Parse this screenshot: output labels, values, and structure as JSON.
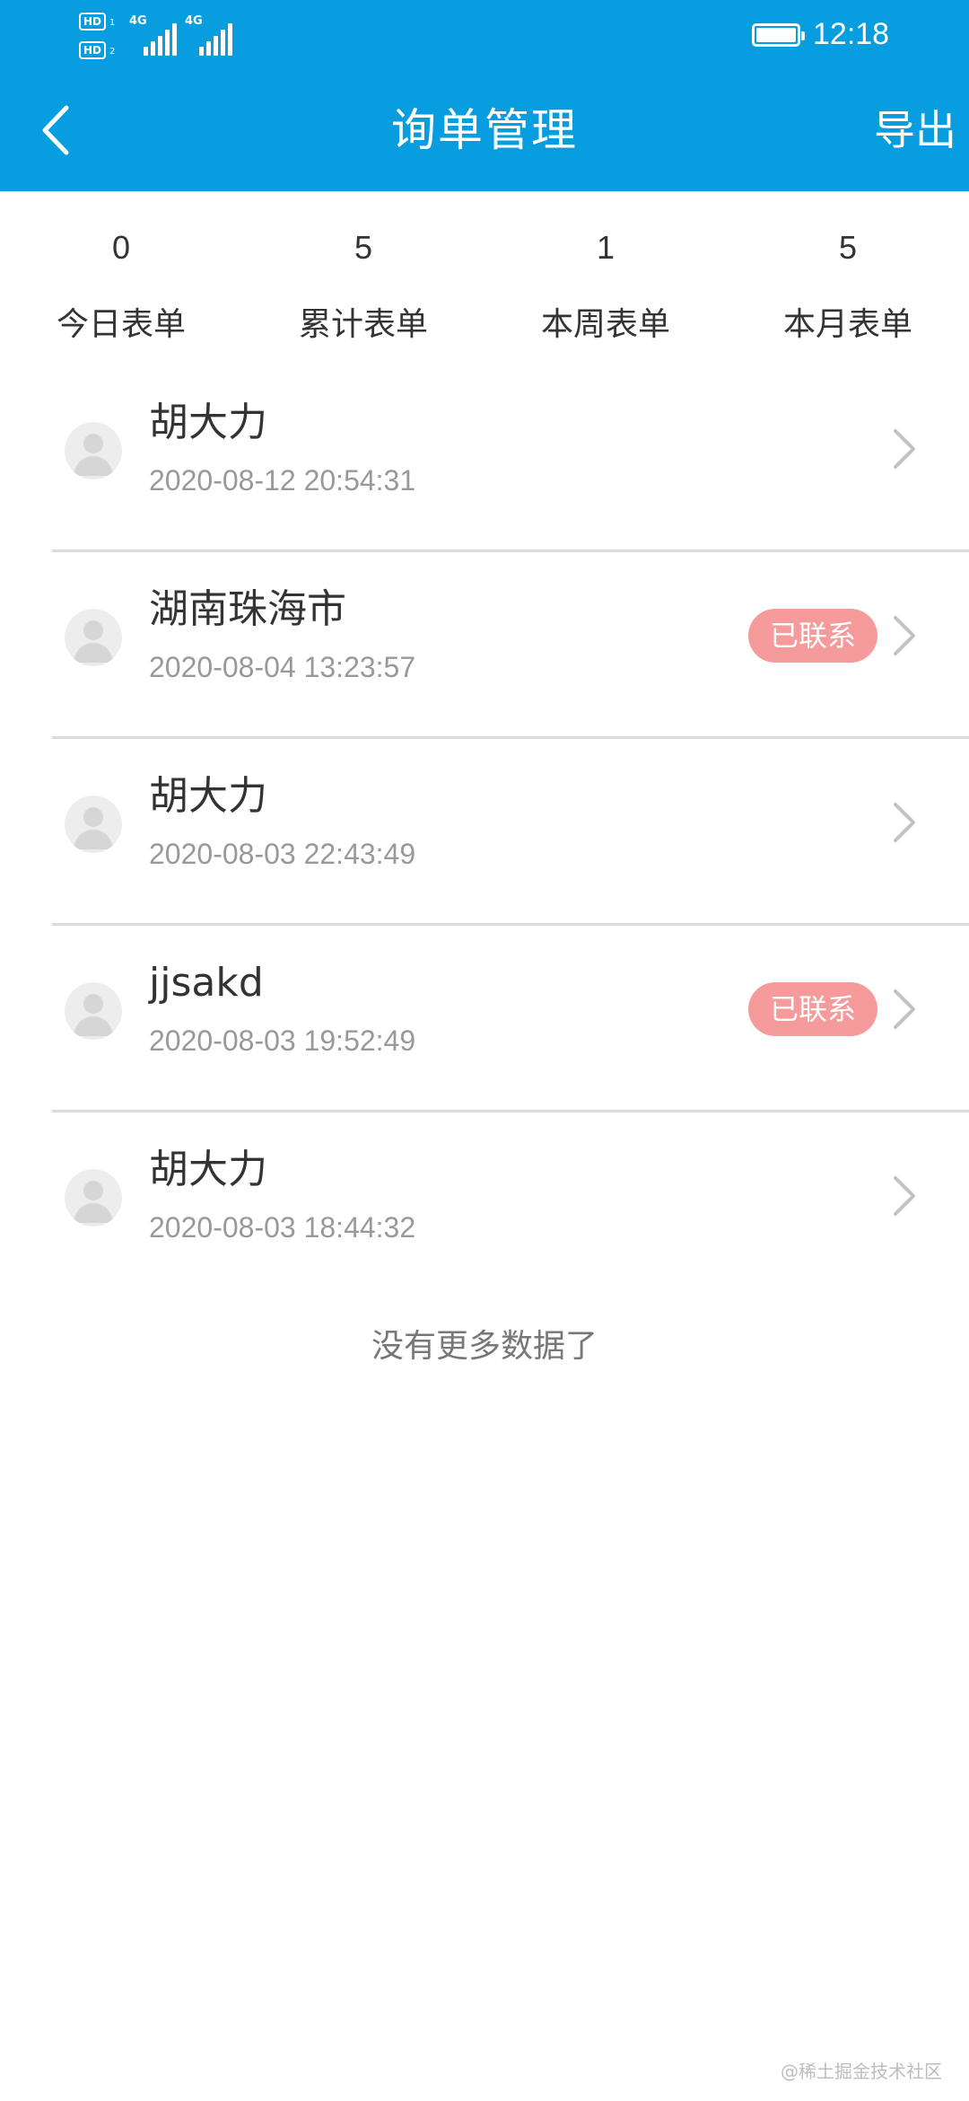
{
  "status_bar": {
    "hd1": "HD",
    "hd2": "HD",
    "sim1": "1",
    "sim2": "2",
    "net1": "4G",
    "net2": "4G",
    "time": "12:18"
  },
  "nav": {
    "title": "询单管理",
    "export_label": "导出"
  },
  "stats": [
    {
      "value": "0",
      "label": "今日表单"
    },
    {
      "value": "5",
      "label": "累计表单"
    },
    {
      "value": "1",
      "label": "本周表单"
    },
    {
      "value": "5",
      "label": "本月表单"
    }
  ],
  "items": [
    {
      "name": "胡大力",
      "time": "2020-08-12 20:54:31",
      "badge": ""
    },
    {
      "name": "湖南珠海市",
      "time": "2020-08-04 13:23:57",
      "badge": "已联系"
    },
    {
      "name": "胡大力",
      "time": "2020-08-03 22:43:49",
      "badge": ""
    },
    {
      "name": "jjsakd",
      "time": "2020-08-03 19:52:49",
      "badge": "已联系"
    },
    {
      "name": "胡大力",
      "time": "2020-08-03 18:44:32",
      "badge": ""
    }
  ],
  "footer": {
    "no_more": "没有更多数据了",
    "watermark": "@稀土掘金技术社区"
  },
  "colors": {
    "header_bg": "#079ddf",
    "badge_bg": "#f59b9b",
    "divider": "#dcdcdc"
  },
  "icons": {
    "back": "chevron-left-icon",
    "row_arrow": "chevron-right-icon",
    "avatar": "user-avatar-icon",
    "battery": "battery-icon",
    "signal": "signal-icon"
  }
}
